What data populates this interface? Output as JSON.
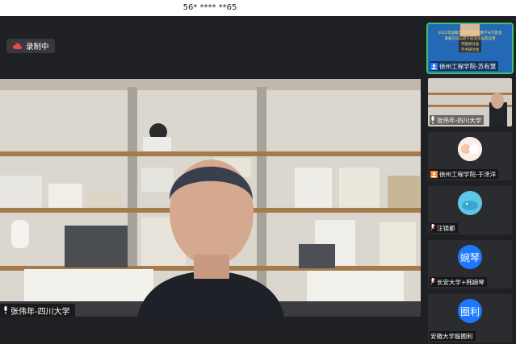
{
  "window": {
    "title": "56* **** **65"
  },
  "recording": {
    "label": "录制中"
  },
  "main": {
    "speaker_name": "张伟年-四川大学"
  },
  "participants": [
    {
      "name": "徐州工程学院-苏有慧",
      "slide_lines": [
        "2022年国家自然科学基金数学天元基金",
        "发展方向与若干前沿论坛及应用",
        "专题研讨会",
        "学术研讨会"
      ]
    },
    {
      "name": "张伟年-四川大学"
    },
    {
      "name": "徐州工程学院-于泽洋"
    },
    {
      "name": "汪锦都"
    },
    {
      "name": "长安大学+韩婉琴",
      "avatar_text": "婉琴"
    },
    {
      "name": "安徽大学殷圈利",
      "avatar_text": "圈利"
    }
  ],
  "colors": {
    "accent": "#3ac36a",
    "avatar_blue": "#1e78ff",
    "panel": "#1f2023"
  }
}
